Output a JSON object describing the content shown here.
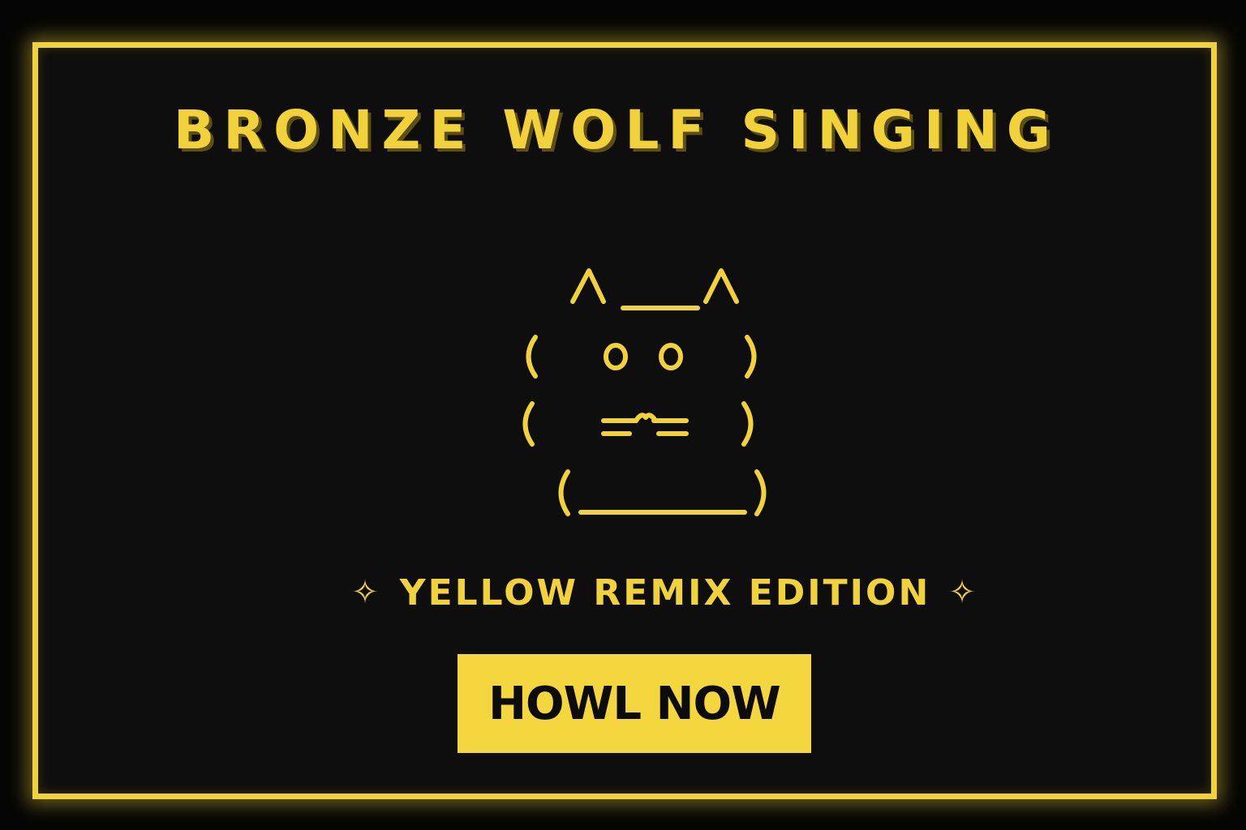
{
  "banner": {
    "title": "BRONZE WOLF SINGING",
    "ascii_art": {
      "line1": "/\\___/\\",
      "line2": "(   o o   )",
      "line3": "(   =^=   )",
      "line4": "(_______)"
    },
    "edition": {
      "star_icon": "✧",
      "label": "YELLOW REMIX EDITION"
    },
    "cta_label": "HOWL NOW"
  },
  "colors": {
    "accent": "#f2d23a",
    "background": "#0e0e0e",
    "button_text": "#0c0c0c"
  }
}
